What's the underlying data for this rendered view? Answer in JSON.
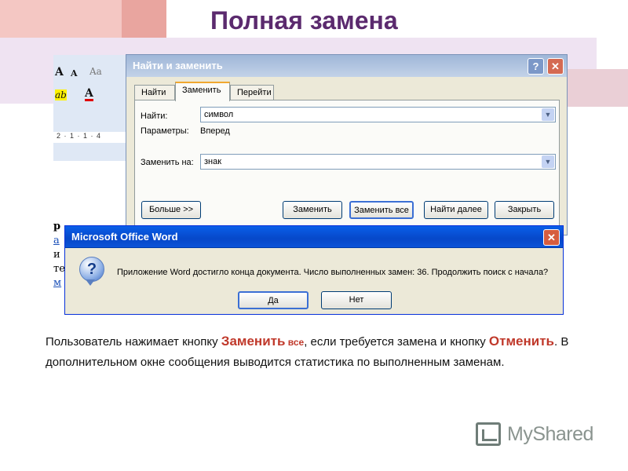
{
  "slide": {
    "title": "Полная замена"
  },
  "ribbon": {
    "font_grow": "A",
    "font_shrink": "A",
    "clear_format": "Aa",
    "highlight": "ab",
    "font_color": "A",
    "ruler": "2 · 1 · 1 · 4",
    "doc_chars": [
      "р",
      "а",
      "и",
      "",
      "те",
      "м"
    ]
  },
  "find_replace": {
    "title": "Найти и заменить",
    "help_label": "?",
    "close_label": "✕",
    "tabs": [
      "Найти",
      "Заменить",
      "Перейти"
    ],
    "find_label": "Найти:",
    "find_value": "символ",
    "params_label": "Параметры:",
    "params_value": "Вперед",
    "replace_label": "Заменить на:",
    "replace_value": "знак",
    "buttons": {
      "more": "Больше >>",
      "replace": "Заменить",
      "replace_all": "Заменить все",
      "find_next": "Найти далее",
      "close": "Закрыть"
    }
  },
  "message_box": {
    "title": "Microsoft Office Word",
    "close_label": "✕",
    "icon_glyph": "?",
    "message": "Приложение Word достигло конца документа. Число выполненных замен: 36. Продолжить поиск с начала?",
    "yes": "Да",
    "no": "Нет"
  },
  "description": {
    "p1": "Пользователь нажимает кнопку ",
    "accent1": "Заменить",
    "accent1_small": " все",
    "p2": ", если требуется замена и кнопку ",
    "accent2": "Отменить",
    "p3": ". В дополнительном окне сообщения выводится статистика по выполненным заменам."
  },
  "logo": {
    "text": "MyShared"
  },
  "colors": {
    "title": "#5b2a6e",
    "accent": "#c0392b",
    "xp_blue": "#0648c9"
  }
}
